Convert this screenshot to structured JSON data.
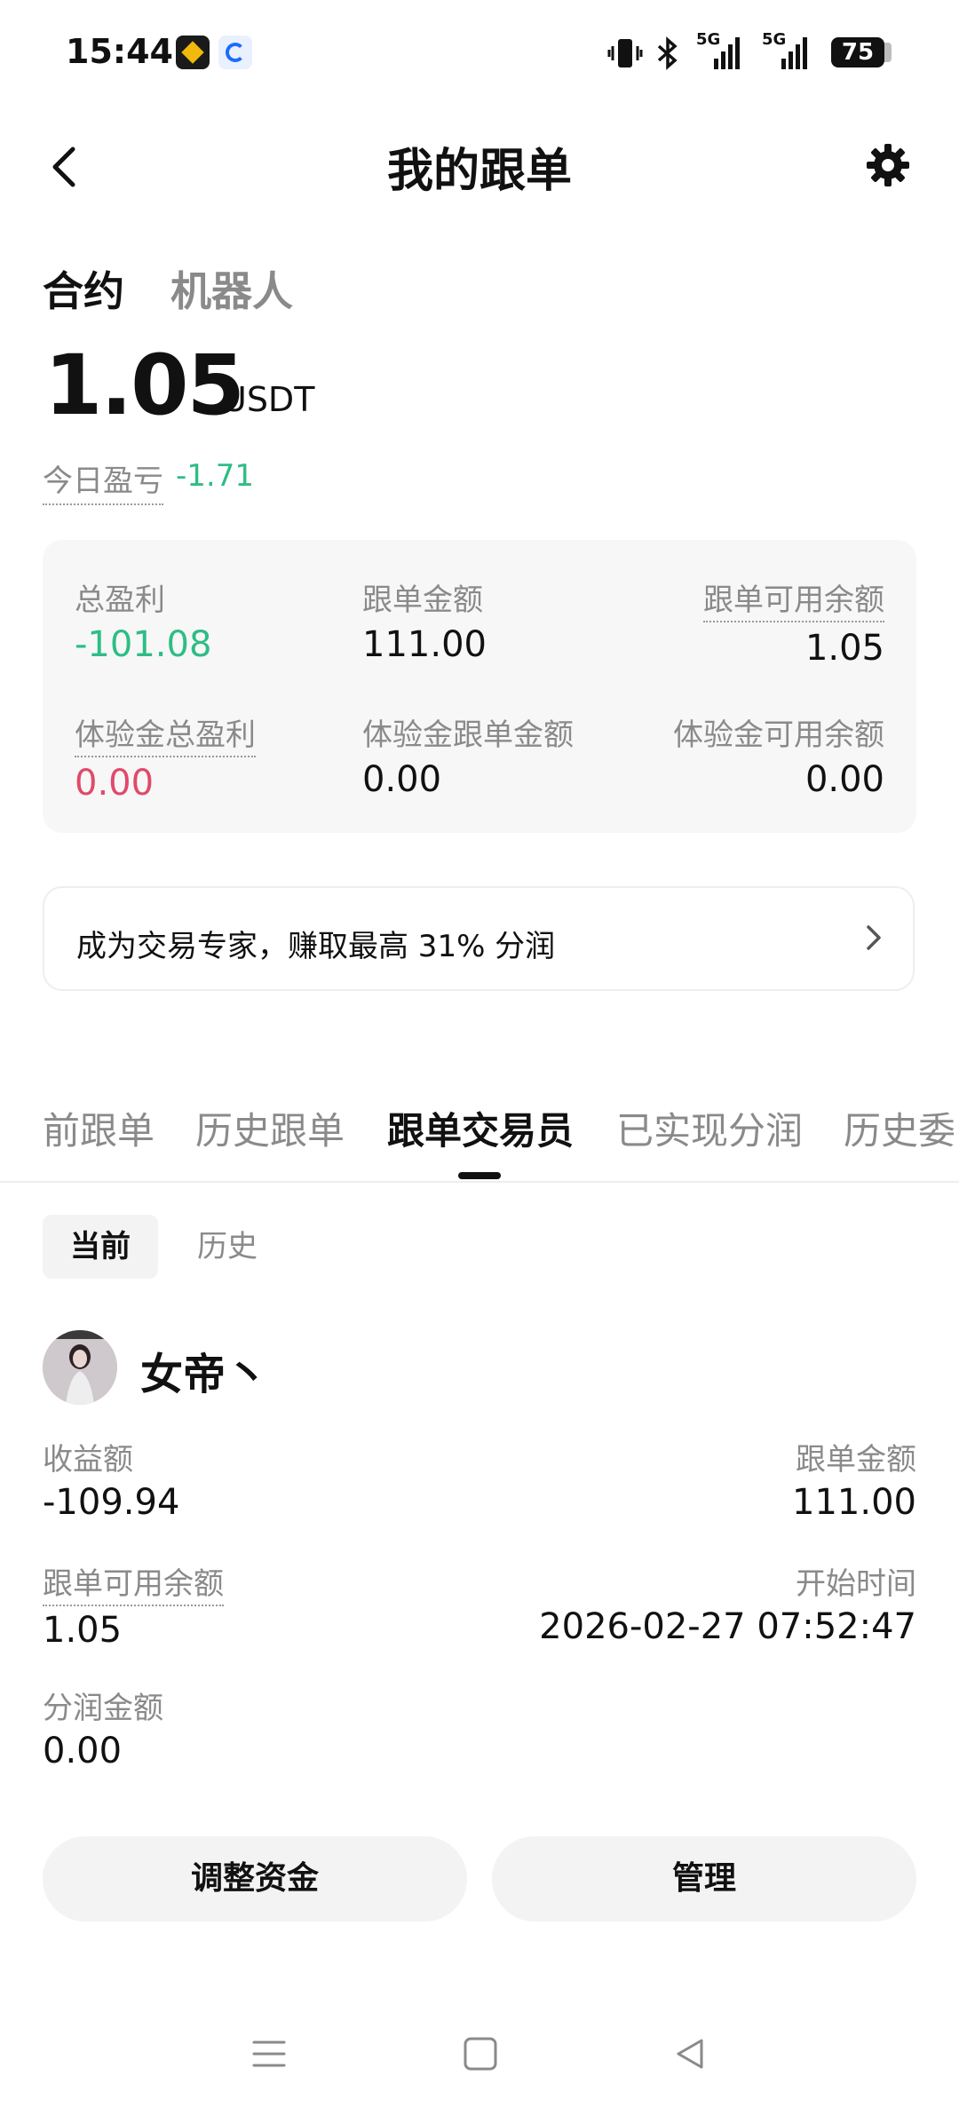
{
  "status_bar": {
    "time": "15:44",
    "network_1": "5G",
    "network_2": "5G",
    "battery": "75"
  },
  "header": {
    "title": "我的跟单",
    "back_icon": "chevron-left-icon",
    "settings_icon": "gear-icon"
  },
  "segments": {
    "active": "合约",
    "inactive": "机器人"
  },
  "balance": {
    "value": "1.05",
    "unit": "USDT",
    "today_label": "今日盈亏",
    "today_value": "-1.71"
  },
  "stats": {
    "total_profit_label": "总盈利",
    "total_profit_value": "-101.08",
    "copy_amount_label": "跟单金额",
    "copy_amount_value": "111.00",
    "copy_available_label": "跟单可用余额",
    "copy_available_value": "1.05",
    "trial_profit_label": "体验金总盈利",
    "trial_profit_value": "0.00",
    "trial_copy_label": "体验金跟单金额",
    "trial_copy_value": "0.00",
    "trial_available_label": "体验金可用余额",
    "trial_available_value": "0.00"
  },
  "promo": {
    "text": "成为交易专家，赚取最高 31% 分润"
  },
  "tabs": [
    {
      "label": "前跟单"
    },
    {
      "label": "历史跟单"
    },
    {
      "label": "跟单交易员"
    },
    {
      "label": "已实现分润"
    },
    {
      "label": "历史委"
    }
  ],
  "chips": {
    "active": "当前",
    "inactive": "历史"
  },
  "trader": {
    "name": "女帝丶",
    "profit_label": "收益额",
    "profit_value": "-109.94",
    "copy_amount_label": "跟单金额",
    "copy_amount_value": "111.00",
    "available_label": "跟单可用余额",
    "available_value": "1.05",
    "start_label": "开始时间",
    "start_value": "2026-02-27 07:52:47",
    "share_label": "分润金额",
    "share_value": "0.00"
  },
  "actions": {
    "adjust": "调整资金",
    "manage": "管理"
  },
  "colors": {
    "profit_green": "#2ebd85",
    "loss_red": "#e04a6a",
    "muted": "#8a8a8a"
  }
}
